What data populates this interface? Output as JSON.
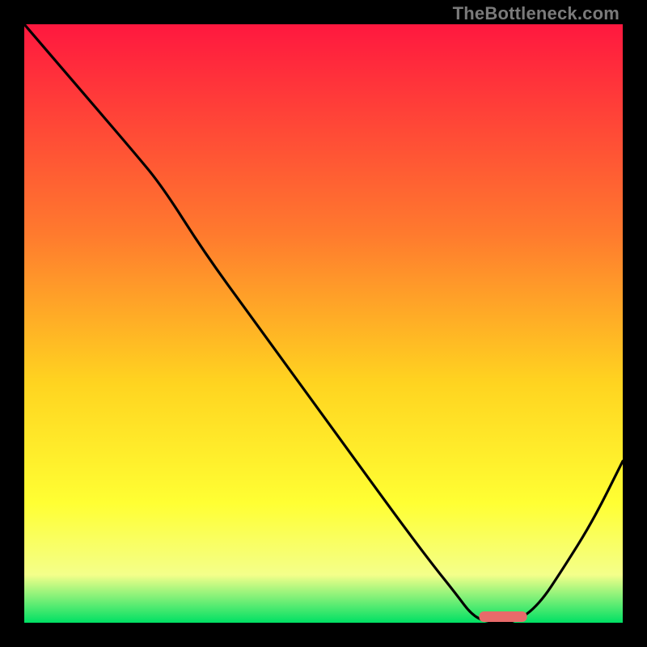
{
  "watermark": "TheBottleneck.com",
  "colors": {
    "gradient_top": "#ff183f",
    "gradient_mid1": "#ff7a2e",
    "gradient_mid2": "#ffd420",
    "gradient_mid3": "#ffff33",
    "gradient_mid4": "#f4ff8a",
    "gradient_bottom": "#00e064",
    "curve": "#000000",
    "marker": "#e86a6a",
    "frame_bg": "#000000"
  },
  "chart_data": {
    "type": "line",
    "title": "",
    "xlabel": "",
    "ylabel": "",
    "xlim": [
      0,
      100
    ],
    "ylim": [
      0,
      100
    ],
    "series": [
      {
        "name": "bottleneck-curve",
        "x": [
          0,
          6,
          12,
          18,
          23,
          30,
          38,
          46,
          54,
          62,
          68,
          72,
          75,
          78,
          82,
          86,
          90,
          95,
          100
        ],
        "y": [
          100,
          93,
          86,
          79,
          73,
          62,
          51,
          40,
          29,
          18,
          10,
          5,
          1,
          0,
          0,
          3,
          9,
          17,
          27
        ]
      }
    ],
    "marker": {
      "name": "optimal-range",
      "x_start": 76,
      "x_end": 84,
      "y": 0
    },
    "gradient_stops": [
      {
        "pct": 0,
        "value": 100
      },
      {
        "pct": 35,
        "value": 65
      },
      {
        "pct": 60,
        "value": 40
      },
      {
        "pct": 80,
        "value": 20
      },
      {
        "pct": 92,
        "value": 8
      },
      {
        "pct": 100,
        "value": 0
      }
    ]
  }
}
